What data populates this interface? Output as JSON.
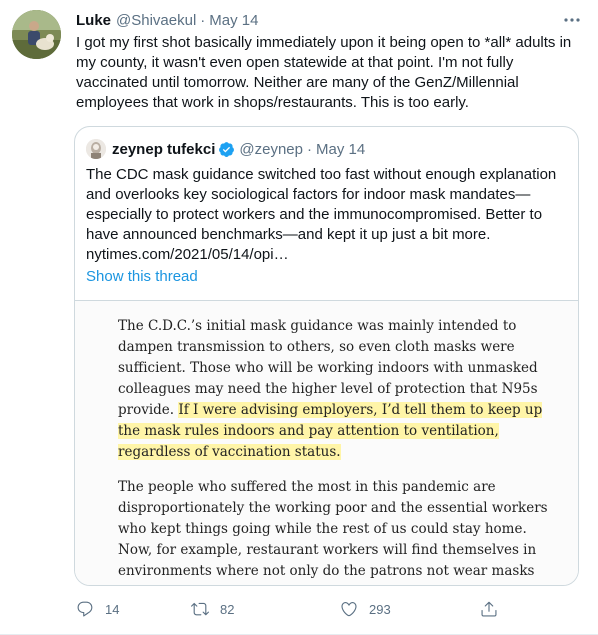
{
  "tweet": {
    "author_name": "Luke",
    "handle": "@Shivaekul",
    "separator": "·",
    "date": "May 14",
    "text": "I got my first shot basically immediately upon it being open to *all* adults in my county, it wasn't even open statewide at that point. I'm not fully vaccinated until tomorrow. Neither are many of the GenZ/Millennial employees that work in shops/restaurants. This is too early."
  },
  "quoted": {
    "author_name": "zeynep tufekci",
    "handle": "@zeynep",
    "separator": "·",
    "date": "May 14",
    "text": "The CDC mask guidance switched too fast without enough explanation and overlooks key sociological factors for indoor mask mandates—especially to protect workers and the immunocompromised. Better to have announced benchmarks—and kept it up just a bit more. nytimes.com/2021/05/14/opi…",
    "show_thread": "Show this thread",
    "article": {
      "p1_normal": "The C.D.C.’s initial mask guidance was mainly intended to dampen transmission to others, so even cloth masks were sufficient. Those who will be working indoors with unmasked colleagues may need the higher level of protection that N95s provide. ",
      "p1_highlight": "If I were advising employers, I’d tell them to keep up the mask rules indoors and pay attention to ventilation, regardless of vaccination status.",
      "p2": "The people who suffered the most in this pandemic are disproportionately the working poor and the essential workers who kept things going while the rest of us could stay home. Now, for example, restaurant workers will find themselves in environments where not only do the patrons not wear masks but the staff may feel pressure not to."
    }
  },
  "actions": {
    "reply_count": "14",
    "retweet_count": "82",
    "like_count": "293"
  },
  "colors": {
    "accent": "#1b95e0",
    "secondary_text": "#5b7083",
    "highlight": "#fff5a8"
  },
  "icons": [
    "more-icon",
    "verified-badge-icon",
    "reply-icon",
    "retweet-icon",
    "like-icon",
    "share-icon"
  ]
}
